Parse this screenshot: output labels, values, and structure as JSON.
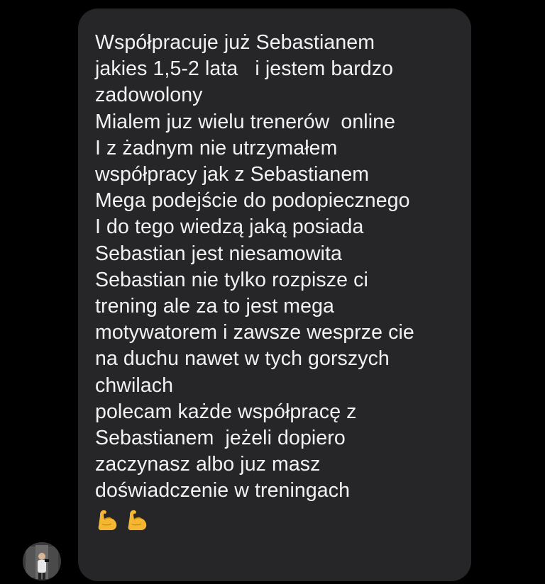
{
  "message": {
    "lines": [
      "Współpracuje już Sebastianem",
      "jakies 1,5-2 lata   i jestem bardzo",
      "zadowolony",
      "Mialem juz wielu trenerów  online",
      "I z żadnym nie utrzymałem",
      "współpracy jak z Sebastianem",
      "Mega podejście do podopiecznego",
      "I do tego wiedzą jaką posiada",
      "Sebastian jest niesamowita",
      "Sebastian nie tylko rozpisze ci",
      "trening ale za to jest mega",
      "motywatorem i zawsze wesprze cie",
      "na duchu nawet w tych gorszych",
      "chwilach",
      "polecam każde współpracę z",
      "Sebastianem  jeżeli dopiero",
      "zaczynasz albo juz masz",
      "doświadczenie w treningach"
    ],
    "emojis": [
      "flexed-biceps-icon",
      "flexed-biceps-icon"
    ]
  },
  "colors": {
    "background": "#000000",
    "bubble": "#262629",
    "text": "#f2f2f4",
    "emoji": "#f5b731"
  },
  "sender": {
    "avatar": "avatar-photo"
  }
}
